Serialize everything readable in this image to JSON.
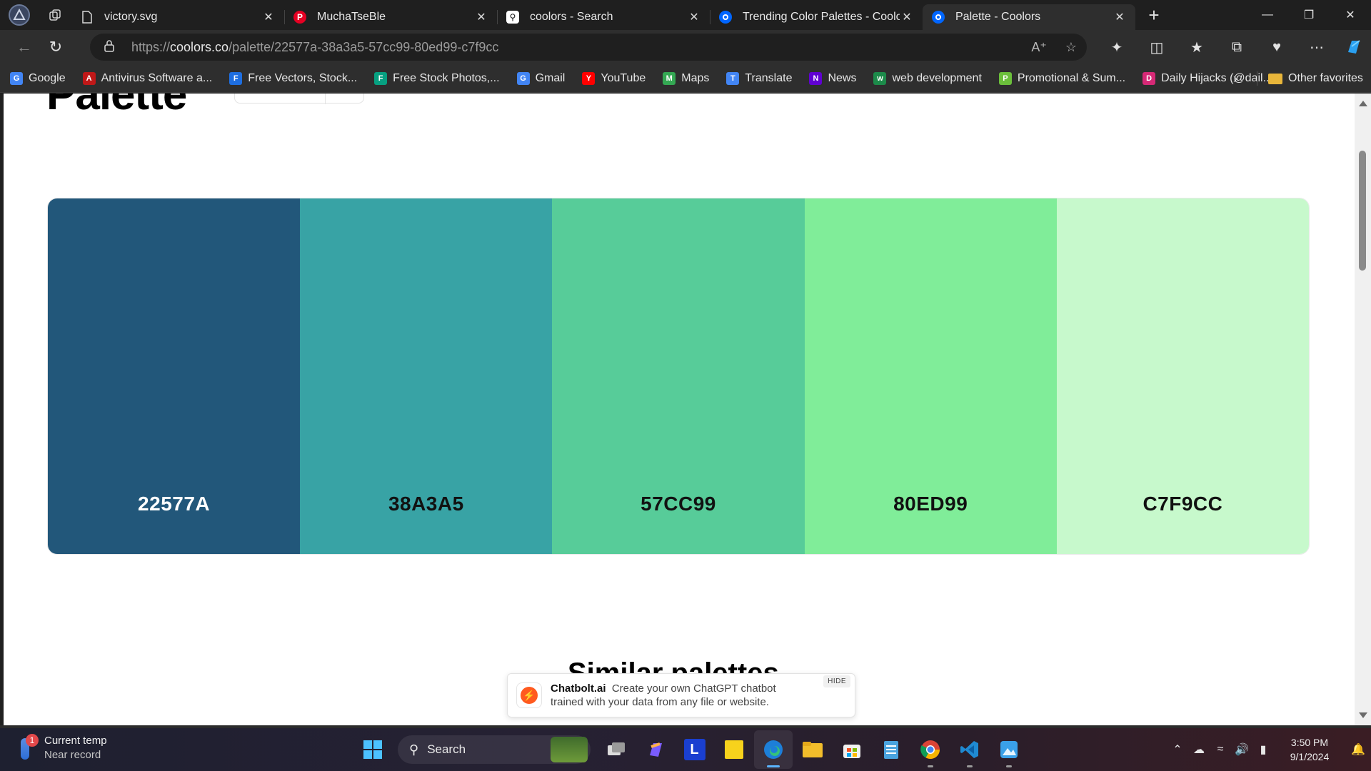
{
  "browser": {
    "tabs": [
      {
        "title": "victory.svg",
        "icon": "file-icon",
        "active": false
      },
      {
        "title": "MuchaTseBle",
        "icon": "pinterest-icon",
        "active": false
      },
      {
        "title": "coolors - Search",
        "icon": "search-tab-icon",
        "active": false
      },
      {
        "title": "Trending Color Palettes - Coolors",
        "icon": "coolors-icon",
        "active": false
      },
      {
        "title": "Palette - Coolors",
        "icon": "coolors-icon",
        "active": true
      }
    ],
    "url": {
      "scheme": "https://",
      "domain": "coolors.co",
      "path": "/palette/22577a-38a3a5-57cc99-80ed99-c7f9cc"
    },
    "bookmarks": [
      {
        "label": "Google",
        "icon": "google-icon",
        "color": "#4285f4"
      },
      {
        "label": "Antivirus Software a...",
        "icon": "mcafee-icon",
        "color": "#c01818"
      },
      {
        "label": "Free Vectors, Stock...",
        "icon": "freepik-icon",
        "color": "#1e6ee0"
      },
      {
        "label": "Free Stock Photos,...",
        "icon": "pexels-icon",
        "color": "#07a081"
      },
      {
        "label": "Gmail",
        "icon": "google-icon",
        "color": "#4285f4"
      },
      {
        "label": "YouTube",
        "icon": "youtube-icon",
        "color": "#ff0000"
      },
      {
        "label": "Maps",
        "icon": "maps-icon",
        "color": "#34a853"
      },
      {
        "label": "Translate",
        "icon": "translate-icon",
        "color": "#4285f4"
      },
      {
        "label": "News",
        "icon": "yahoo-icon",
        "color": "#6001d2"
      },
      {
        "label": "web development",
        "icon": "webdev-icon",
        "color": "#1c8a4a"
      },
      {
        "label": "Promotional & Sum...",
        "icon": "leaf-icon",
        "color": "#6bbf3b"
      },
      {
        "label": "Daily Hijacks (@dail...",
        "icon": "instagram-icon",
        "color": "#d62976"
      }
    ],
    "other_favorites": "Other favorites"
  },
  "palette": {
    "colors": [
      {
        "hex": "22577A",
        "bg": "#22577a",
        "fg": "#ffffff"
      },
      {
        "hex": "38A3A5",
        "bg": "#38a3a5",
        "fg": "#111111"
      },
      {
        "hex": "57CC99",
        "bg": "#57cc99",
        "fg": "#111111"
      },
      {
        "hex": "80ED99",
        "bg": "#80ed99",
        "fg": "#111111"
      },
      {
        "hex": "C7F9CC",
        "bg": "#c7f9cc",
        "fg": "#111111"
      }
    ]
  },
  "ad": {
    "brand": "Chatbolt.ai",
    "line1": "Create your own ChatGPT chatbot",
    "line2": "trained with your data from any file or website.",
    "hide": "HIDE"
  },
  "taskbar": {
    "weather_title": "Current temp",
    "weather_sub": "Near record",
    "weather_badge": "1",
    "search_placeholder": "Search",
    "time": "3:50 PM",
    "date": "9/1/2024"
  }
}
